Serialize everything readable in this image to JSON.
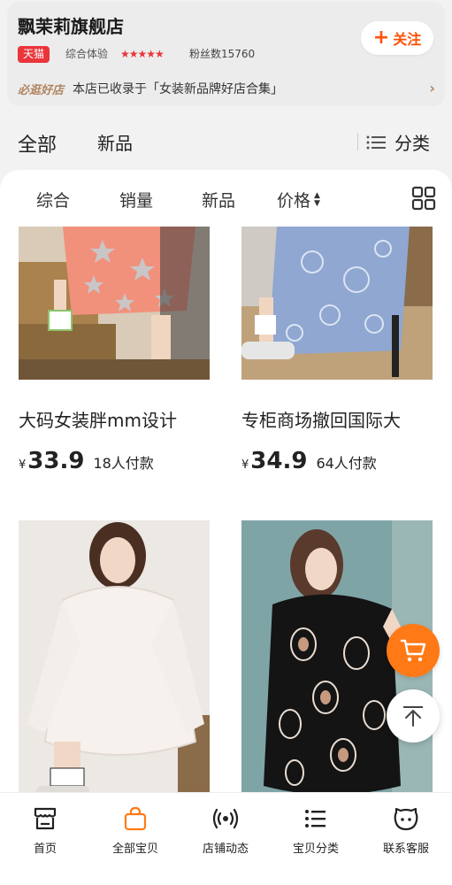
{
  "store": {
    "name": "飘茉莉旗舰店",
    "badge": "天猫",
    "rating_label": "综合体验",
    "stars": "★★★★★",
    "fans": "粉丝数15760",
    "follow_label": "关注",
    "collection_tag": "必逛好店",
    "collection_text": "本店已收录于「女装新品牌好店合集」"
  },
  "main_tabs": {
    "all": "全部",
    "new": "新品",
    "category": "分类"
  },
  "sort_bar": {
    "composite": "综合",
    "sales": "销量",
    "new": "新品",
    "price": "价格"
  },
  "products": [
    {
      "title": "大码女装胖mm设计",
      "yen": "¥",
      "price": "33.9",
      "sold": "18人付款"
    },
    {
      "title": "专柜商场撤回国际大",
      "yen": "¥",
      "price": "34.9",
      "sold": "64人付款"
    },
    {
      "title": "",
      "yen": "",
      "price": "",
      "sold": ""
    },
    {
      "title": "",
      "yen": "",
      "price": "",
      "sold": ""
    }
  ],
  "bottom_nav": [
    {
      "label": "首页",
      "icon": "shop-icon"
    },
    {
      "label": "全部宝贝",
      "icon": "bag-icon"
    },
    {
      "label": "店铺动态",
      "icon": "broadcast-icon"
    },
    {
      "label": "宝贝分类",
      "icon": "list-icon"
    },
    {
      "label": "联系客服",
      "icon": "chat-icon"
    }
  ],
  "colors": {
    "accent": "#ff5000",
    "tmall_red": "#e9353a",
    "cart_orange": "#ff7a16",
    "active_nav": "#ff5000"
  }
}
